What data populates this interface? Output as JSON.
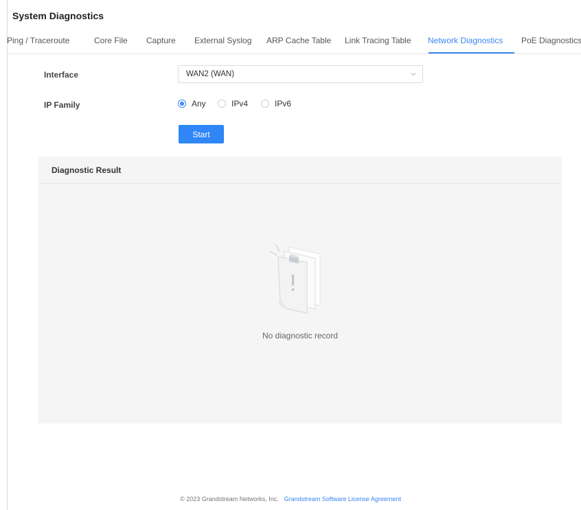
{
  "page": {
    "title": "System Diagnostics"
  },
  "tabs": [
    {
      "label": "Ping / Traceroute"
    },
    {
      "label": "Core File"
    },
    {
      "label": "Capture"
    },
    {
      "label": "External Syslog"
    },
    {
      "label": "ARP Cache Table"
    },
    {
      "label": "Link Tracing Table"
    },
    {
      "label": "Network Diagnostics",
      "active": true
    },
    {
      "label": "PoE Diagnostics"
    }
  ],
  "form": {
    "interface": {
      "label": "Interface",
      "value": "WAN2 (WAN)",
      "icon": "chevron-down-icon"
    },
    "ip_family": {
      "label": "IP Family",
      "options": [
        {
          "label": "Any",
          "checked": true
        },
        {
          "label": "IPv4",
          "checked": false
        },
        {
          "label": "IPv6",
          "checked": false
        }
      ]
    },
    "start_label": "Start"
  },
  "result": {
    "title": "Diagnostic Result",
    "empty_text": "No diagnostic record",
    "icon": "empty-document-icon"
  },
  "footer": {
    "copyright": "© 2023 Grandstream Networks, Inc.",
    "license_link": "Grandstream Software License Agreement"
  },
  "colors": {
    "accent": "#3b86f0",
    "button": "#2f86f6",
    "panel_bg": "#f5f5f5"
  }
}
